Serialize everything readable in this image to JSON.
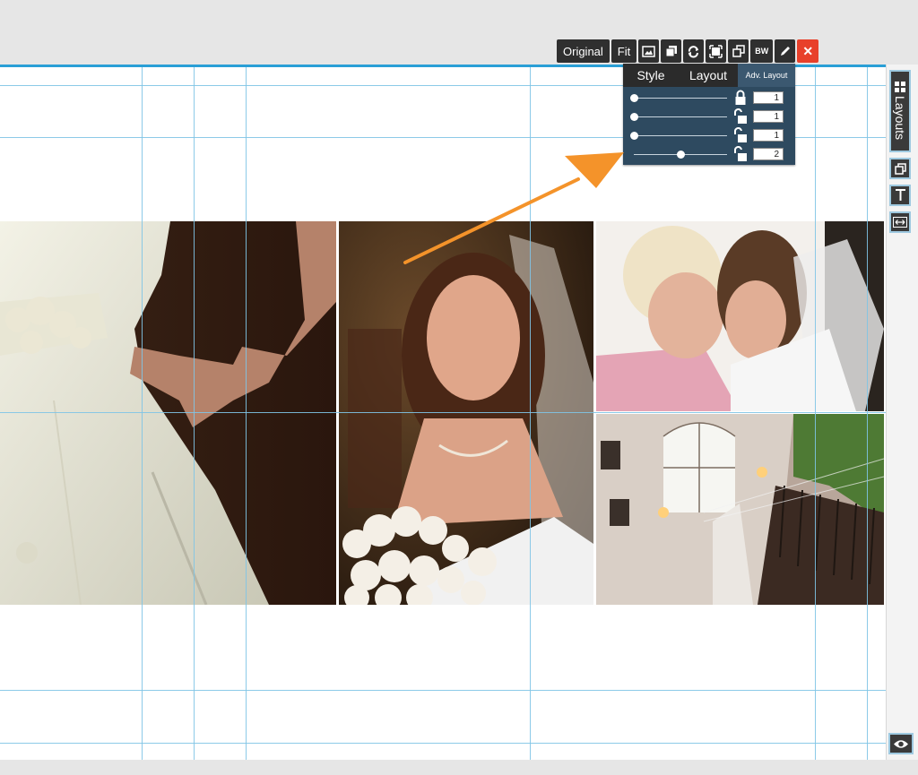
{
  "toolbar": {
    "original_label": "Original",
    "fit_label": "Fit",
    "bw_label": "BW",
    "close_label": "✕"
  },
  "panel": {
    "tabs": [
      "Style",
      "Layout",
      "Adv. Layout"
    ],
    "rows": [
      {
        "value": "1",
        "slider_level": 0.0,
        "locked": true
      },
      {
        "value": "1",
        "slider_level": 0.0,
        "locked": false
      },
      {
        "value": "1",
        "slider_level": 0.0,
        "locked": false
      },
      {
        "value": "2",
        "slider_level": 0.5,
        "locked": false
      }
    ]
  },
  "rail": {
    "layouts_label": "Layouts",
    "icons": [
      "grid-icon",
      "copy-layer-icon",
      "text-icon",
      "resize-horizontal-icon",
      "eye-icon"
    ]
  },
  "colors": {
    "guide": "#7fc4e6",
    "accent": "#2a9fd6",
    "close": "#e8402a",
    "arrow": "#f4932a"
  }
}
